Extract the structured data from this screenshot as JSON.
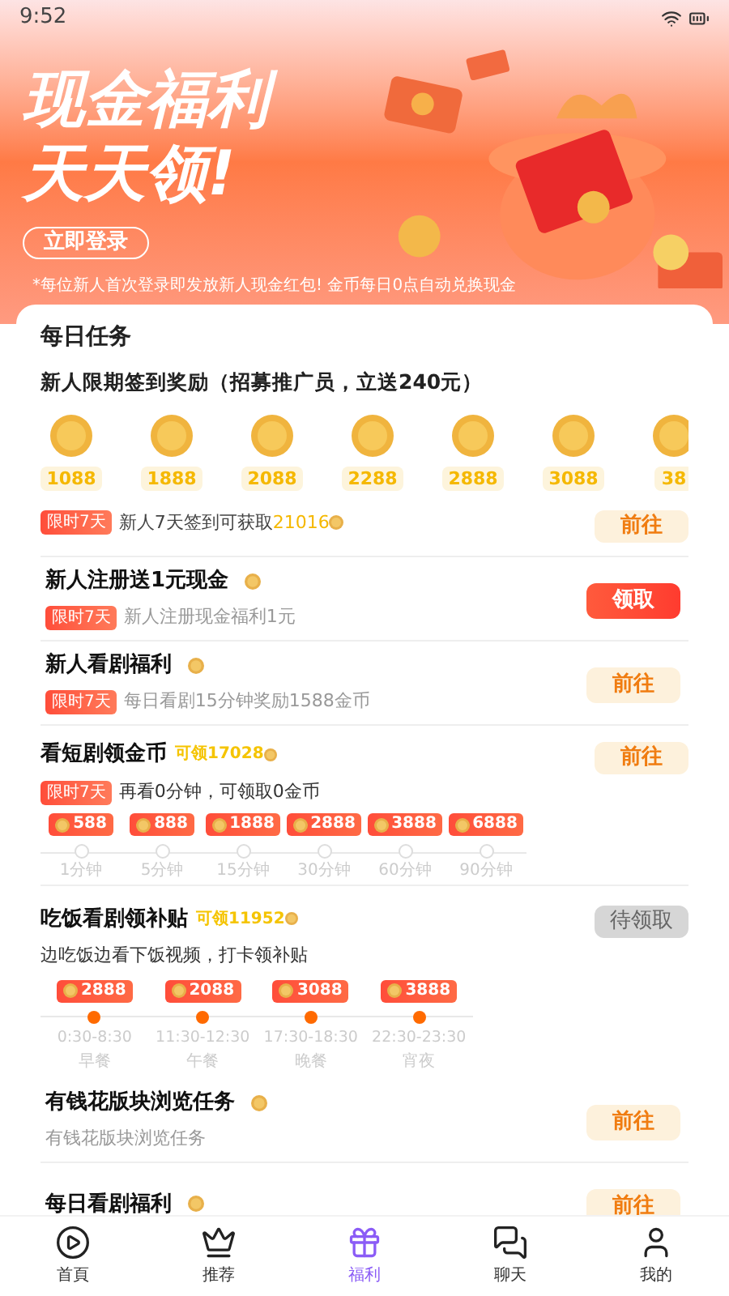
{
  "status_bar": {
    "time": "9:52"
  },
  "banner": {
    "title_lines": [
      "现金福利",
      "天天领!"
    ],
    "login_button": "立即登录",
    "note": "*每位新人首次登录即发放新人现金红包! 金币每日0点自动兑换现金"
  },
  "daily_tasks": {
    "title": "每日任务",
    "signin": {
      "title": "新人限期签到奖励（招募推广员，立送240元）",
      "rewards": [
        "1088",
        "1888",
        "2088",
        "2288",
        "2888",
        "3088",
        "38"
      ],
      "tag": "限时7天",
      "text": "新人7天签到可获取",
      "highlight": "21016",
      "button": {
        "label": "前往",
        "kind": "light"
      }
    },
    "tasks": [
      {
        "kind": "simple",
        "title": "新人注册送1元现金",
        "tag": "限时7天",
        "subtitle": "新人注册现金福利1元",
        "button": {
          "label": "领取",
          "kind": "primary"
        }
      },
      {
        "kind": "simple",
        "title": "新人看剧福利",
        "tag": "限时7天",
        "subtitle": "每日看剧15分钟奖励1588金币",
        "button": {
          "label": "前往",
          "kind": "light"
        }
      },
      {
        "kind": "watch",
        "title": "看短剧领金币",
        "bonus": "可领17028",
        "tag": "限时7天",
        "subtitle": "再看0分钟，可领取0金币",
        "button": {
          "label": "前往",
          "kind": "light"
        },
        "milestones": [
          {
            "reward": "588",
            "time": "1分钟"
          },
          {
            "reward": "888",
            "time": "5分钟"
          },
          {
            "reward": "1888",
            "time": "15分钟"
          },
          {
            "reward": "2888",
            "time": "30分钟"
          },
          {
            "reward": "3888",
            "time": "60分钟"
          },
          {
            "reward": "6888",
            "time": "90分钟"
          }
        ]
      },
      {
        "kind": "meal",
        "title": "吃饭看剧领补贴",
        "bonus": "可领11952",
        "subtitle": "边吃饭边看下饭视频，打卡领补贴",
        "button": {
          "label": "待领取",
          "kind": "disabled"
        },
        "slots": [
          {
            "reward": "2888",
            "time": "0:30-8:30",
            "meal": "早餐"
          },
          {
            "reward": "2088",
            "time": "11:30-12:30",
            "meal": "午餐"
          },
          {
            "reward": "3088",
            "time": "17:30-18:30",
            "meal": "晚餐"
          },
          {
            "reward": "3888",
            "time": "22:30-23:30",
            "meal": "宵夜"
          }
        ]
      },
      {
        "kind": "simple",
        "title": "有钱花版块浏览任务",
        "subtitle": "有钱花版块浏览任务",
        "button": {
          "label": "前往",
          "kind": "light"
        }
      },
      {
        "kind": "simple",
        "title": "每日看剧福利",
        "button": {
          "label": "前往",
          "kind": "light"
        }
      }
    ]
  },
  "nav": [
    {
      "label": "首頁",
      "selected": false
    },
    {
      "label": "推荐",
      "selected": false
    },
    {
      "label": "福利",
      "selected": true
    },
    {
      "label": "聊天",
      "selected": false
    },
    {
      "label": "我的",
      "selected": false
    }
  ]
}
